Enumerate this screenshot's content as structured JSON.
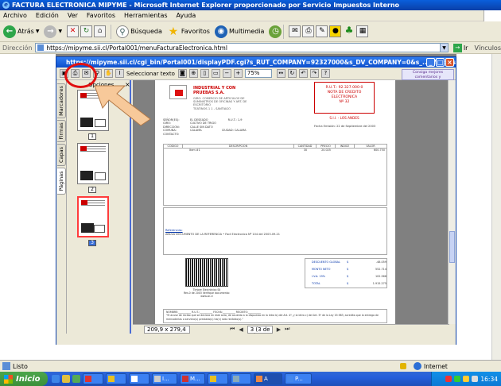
{
  "window": {
    "title": "FACTURA ELECTRONICA MIPYME - Microsoft Internet Explorer proporcionado por Servicio Impuestos Interno"
  },
  "menu": [
    "Archivo",
    "Edición",
    "Ver",
    "Favoritos",
    "Herramientas",
    "Ayuda"
  ],
  "toolbar": {
    "back": "Atrás",
    "search": "Búsqueda",
    "favorites": "Favoritos",
    "multimedia": "Multimedia"
  },
  "address": {
    "label": "Dirección",
    "url": "https://mipyme.sii.cl/Portal001/menuFacturaElectronica.html",
    "go": "Ir",
    "links": "Vínculos"
  },
  "popup": {
    "title": "https://mipyme.sii.cl/cgi_bin/Portal001/displayPDF.cgi?s_RUT_COMPANY=92327000&s_DV_COMPANY=0&s_...- Microsoft Internet Explorer p",
    "select_text": "Seleccionar texto",
    "zoom": "75%",
    "promo": "Consiga mejores comentarios y aprobaciones más rápidas",
    "options": "Opciones",
    "tabs": [
      "Marcadores",
      "Firmas",
      "Capas",
      "Páginas"
    ],
    "page_numbers": [
      "1",
      "2",
      "3"
    ],
    "page_size": "209,9 x 279,4 mm",
    "page_nav": "3 (3 de 3)"
  },
  "invoice": {
    "company_name": "INDUSTRIAL Y CON PRUEBAS S.A.",
    "company_lines": [
      "GIRO: COMERCIO DE ARTICULOS DE",
      "SUMINISTROS DE OFICINAS Y ART. DE",
      "ESCRITORIO",
      "TEATINOS 1 1 - SANTIAGO"
    ],
    "rut": "R.U.T.: 92.327.000-0",
    "doc_type": "NOTA DE CREDITO ELECTRONICA",
    "doc_number": "Nº 32",
    "sii_office": "S.I.I. - LOS ANDES",
    "issue_date": "Fecha Emisión: 22 de Septiembre del 2003",
    "client": [
      {
        "k": "SEÑOR(ES):",
        "v": "EL DESEADO"
      },
      {
        "k": "GIRO:",
        "v": "CULTIVO DE TRIGO"
      },
      {
        "k": "DIRECCION:",
        "v": "CALLE SIN DATO"
      },
      {
        "k": "COMUNA:",
        "v": "CALAMA"
      },
      {
        "k": "CONTACTO:",
        "v": ""
      }
    ],
    "client_rut": "R.U.T.:   1-9",
    "client_city": "CIUDAD:   CALAMA",
    "columns": [
      "CODIGO",
      "DESCRIPCION",
      "CANTIDAD",
      "PRECIO",
      "INDICE",
      "VALOR"
    ],
    "items": [
      {
        "code": "",
        "desc": "Item #1",
        "qty": "30",
        "price": "20.025",
        "index": "",
        "value": "600.750"
      }
    ],
    "references_title": "Referencias:",
    "reference": "ANULA DOCUMENTO DE LA REFERENCIA • Fact Electronica Nº 104 del 2003-09-21",
    "timbre": [
      "Timbre Electrónico SII",
      "Res.0 de 2003 Verifique documento:",
      "www.sii.cl"
    ],
    "totals": [
      {
        "label": "DESCUENTO GLOBAL",
        "cur": "$",
        "value": "-48.059"
      },
      {
        "label": "MONTO NETO",
        "cur": "$",
        "value": "552.714"
      },
      {
        "label": "I.V.A. 19%",
        "cur": "$",
        "value": "102.566"
      },
      {
        "label": "TOTAL",
        "cur": "$",
        "value": "1.915.275"
      }
    ],
    "signature_fields": "NOMBRE:__________ R.U.T.:__________ FECHA:__________ RECINTO:__________",
    "signature_note": "\"El acuse de recibo que se declara en este acto, de acuerdo a lo dispuesto en la letra b) del Art. 4º, y la letra c) del Art. 5º de la Ley 19.983, acredita que la entrega de mercaderías o servicio(s) prestado(s) ha(n) sido recibido(s).\""
  },
  "status": {
    "left": "Listo",
    "zone": "Internet"
  },
  "taskbar": {
    "start": "Inicio",
    "tasks": [
      "",
      "",
      "",
      "I...",
      "M...",
      "",
      "",
      "A",
      "P..."
    ],
    "clock": "16:34"
  },
  "colors": {
    "ie_title": "#0a3fa8",
    "highlight_red": "#e01010",
    "arrow": "#f7c99a",
    "invoice_red": "#c00000"
  }
}
